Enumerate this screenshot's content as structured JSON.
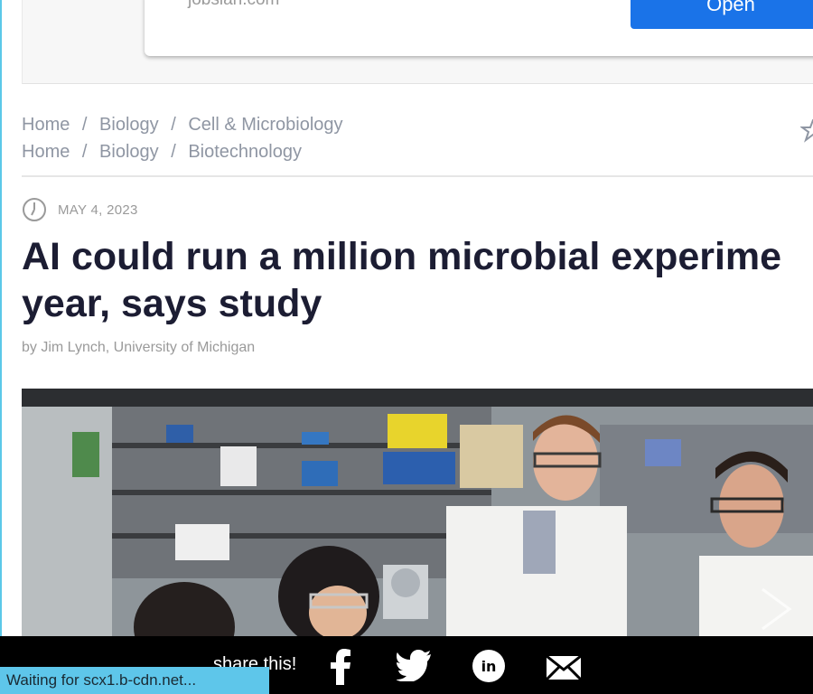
{
  "ad": {
    "domain": "jobsian.com",
    "button_label": "Open"
  },
  "breadcrumbs": [
    [
      "Home",
      "Biology",
      "Cell & Microbiology"
    ],
    [
      "Home",
      "Biology",
      "Biotechnology"
    ]
  ],
  "breadcrumb_separator": "/",
  "article": {
    "date": "MAY 4, 2023",
    "title_line1": "AI could run a million microbial experime",
    "title_line2": "year, says study",
    "byline": "by Jim Lynch, University of Michigan"
  },
  "share": {
    "label": "share this!"
  },
  "status_bar": {
    "text": "Waiting for scx1.b-cdn.net..."
  },
  "colors": {
    "accent": "#1a73e8",
    "headline": "#1c1d33",
    "muted": "#8f96a3",
    "status": "#5ec6ea"
  }
}
